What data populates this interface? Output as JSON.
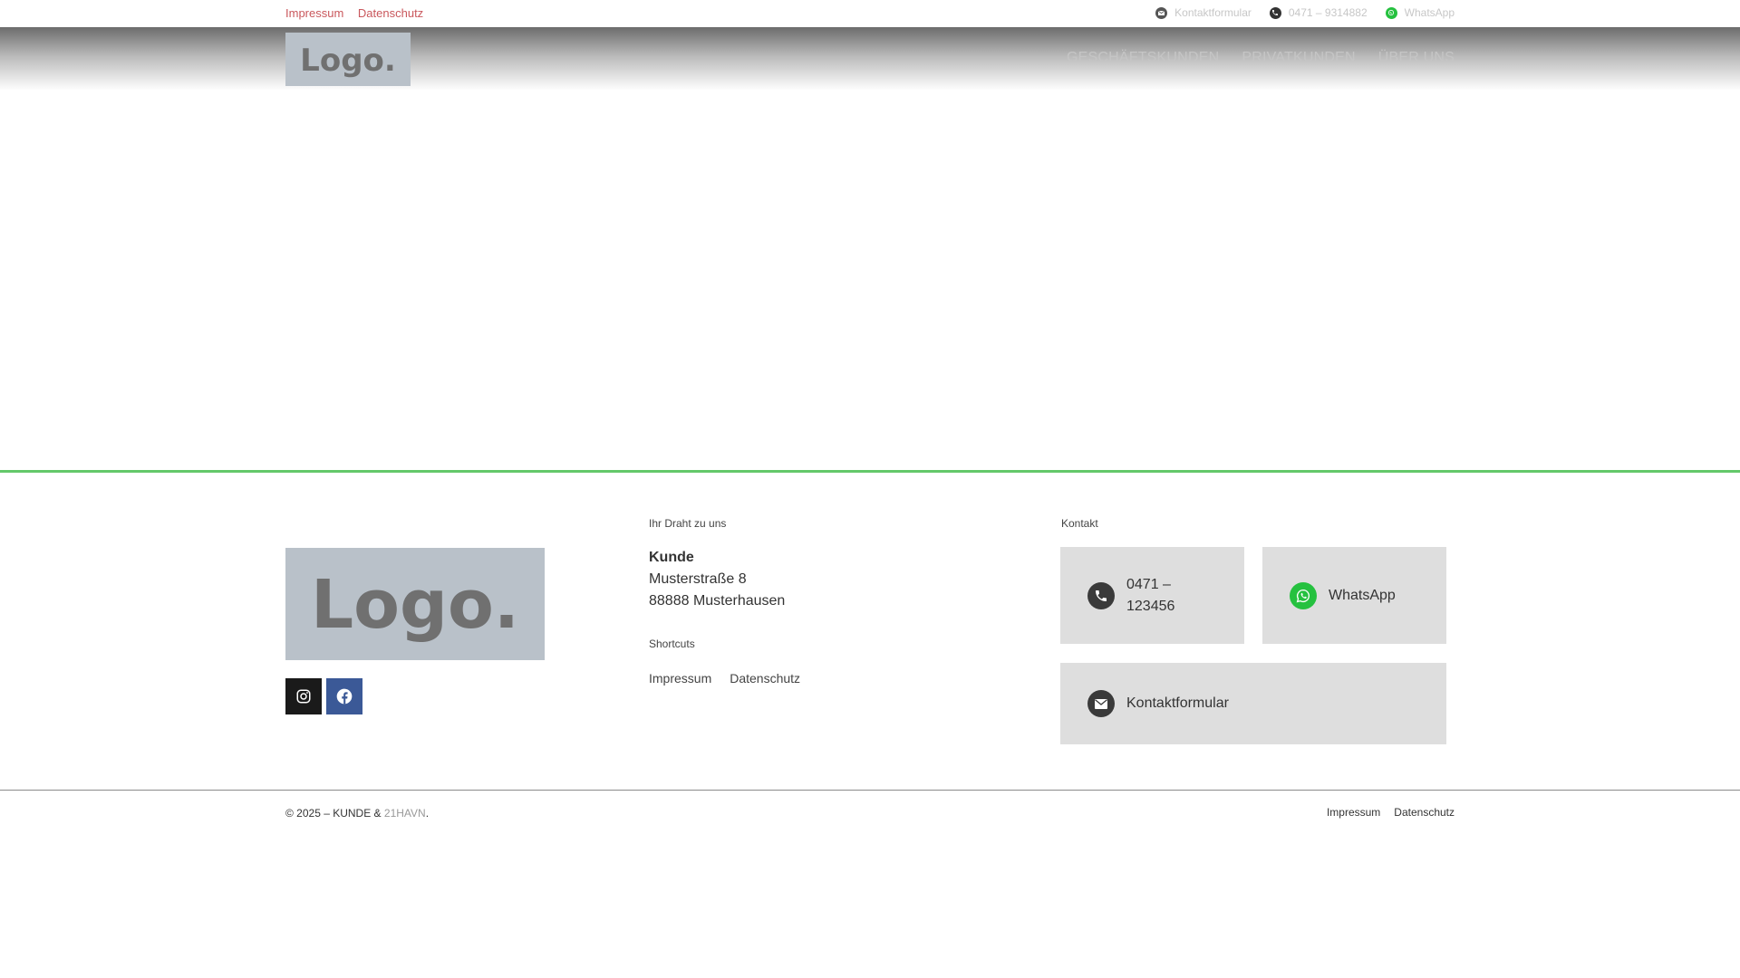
{
  "topbar": {
    "links": [
      "Impressum",
      "Datenschutz"
    ],
    "contact_form": "Kontaktformular",
    "phone": "0471 – 9314882",
    "whatsapp": "WhatsApp"
  },
  "header": {
    "logo_text": "Logo.",
    "nav": [
      "GESCHÄFTSKUNDEN",
      "PRIVATKUNDEN",
      "ÜBER UNS"
    ]
  },
  "footer": {
    "logo_text": "Logo.",
    "draht_label": "Ihr Draht zu uns",
    "address": {
      "name": "Kunde",
      "street": "Musterstraße 8",
      "city": "88888 Musterhausen"
    },
    "shortcuts_label": "Shortcuts",
    "shortcuts": [
      "Impressum",
      "Datenschutz"
    ],
    "kontakt_label": "Kontakt",
    "phone_line1": "0471 –",
    "phone_line2": "123456",
    "whatsapp": "WhatsApp",
    "contact_form": "Kontaktformular"
  },
  "bottom": {
    "copyright": "© 2025 – KUNDE & ",
    "agency": "21HAVN",
    "period": ".",
    "links": [
      "Impressum",
      "Datenschutz"
    ]
  },
  "colors": {
    "accent_red": "#c9575c",
    "green_line": "#64c86a",
    "whatsapp_green": "#25c13f",
    "facebook_blue": "#3b5997"
  }
}
